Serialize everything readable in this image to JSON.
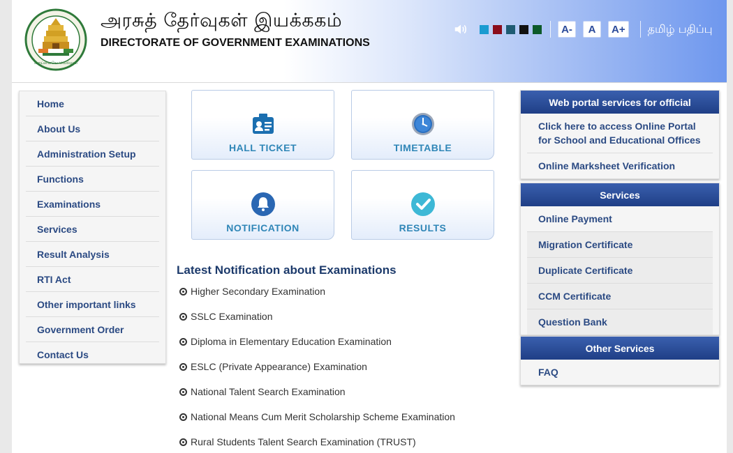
{
  "header": {
    "title_ta": "அரசுத் தேர்வுகள் இயக்ககம்",
    "title_en": "DIRECTORATE OF GOVERNMENT EXAMINATIONS",
    "emblem_text": "தமிழ்நாடு அரசு வாய்மையே வெல்லும்",
    "theme_colors": [
      "#1a9bd1",
      "#8b0d1c",
      "#1e5b73",
      "#111111",
      "#0d5a2a"
    ],
    "font_buttons": [
      "A-",
      "A",
      "A+"
    ],
    "language_link": "தமிழ் பதிப்பு"
  },
  "nav": {
    "items": [
      "Home",
      "About Us",
      "Administration Setup",
      "Functions",
      "Examinations",
      "Services",
      "Result Analysis",
      "RTI Act",
      "Other important links",
      "Government Order",
      "Contact Us"
    ]
  },
  "tiles": {
    "hall_ticket": "HALL TICKET",
    "timetable": "TIMETABLE",
    "notification": "NOTIFICATION",
    "results": "RESULTS"
  },
  "notifications": {
    "heading": "Latest Notification about Examinations",
    "items": [
      "Higher Secondary Examination",
      "SSLC Examination",
      "Diploma in Elementary Education Examination",
      "ESLC (Private Appearance) Examination",
      "National Talent Search Examination",
      "National Means Cum Merit Scholarship Scheme Examination",
      "Rural Students Talent Search Examination (TRUST)"
    ]
  },
  "panels": {
    "web_portal": {
      "title": "Web portal services for official",
      "items": [
        "Click here to access Online Portal for School and Educational Offices",
        "Online Marksheet Verification"
      ]
    },
    "services": {
      "title": "Services",
      "items": [
        "Online Payment",
        "Migration Certificate",
        "Duplicate Certificate",
        "CCM Certificate",
        "Question Bank"
      ]
    },
    "other_services": {
      "title": "Other Services",
      "items": [
        "FAQ"
      ]
    }
  },
  "colors": {
    "nav_text": "#2b4a83",
    "panel_header": "#1f3f86",
    "tile_label": "#2f86b7"
  }
}
